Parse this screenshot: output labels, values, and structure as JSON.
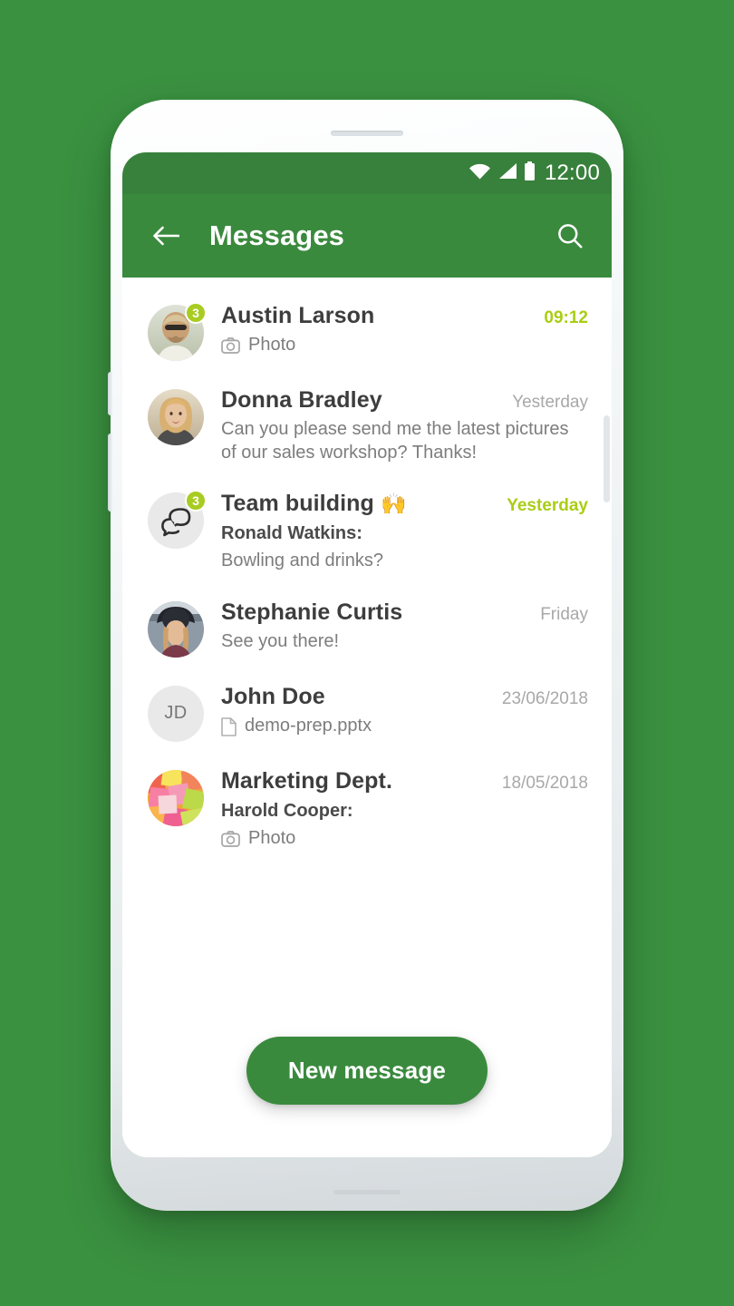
{
  "theme": {
    "backdrop_green": "#3a9140",
    "appbar_green": "#3a8a3e",
    "statusbar_green": "#38813c",
    "accent_lime": "#aacd16",
    "badge_lime": "#a8cc22",
    "name_color": "#3d3d3d",
    "preview_color": "#7d7d7d",
    "muted_time_color": "#a8a8a8"
  },
  "statusbar": {
    "time": "12:00",
    "icons": [
      "wifi-icon",
      "cellular-signal-icon",
      "battery-icon"
    ]
  },
  "appbar": {
    "back_icon": "back-arrow-icon",
    "title": "Messages",
    "search_icon": "search-icon"
  },
  "conversations": [
    {
      "name": "Austin Larson",
      "emoji": "",
      "time": "09:12",
      "time_accent": true,
      "sender": "",
      "preview": "Photo",
      "preview_icon": "camera-icon",
      "badge": "3",
      "avatar_type": "photo-man-sunglasses"
    },
    {
      "name": "Donna Bradley",
      "emoji": "",
      "time": "Yesterday",
      "time_accent": false,
      "sender": "",
      "preview": "Can you please send me the latest pictures of our sales workshop? Thanks!",
      "preview_icon": "",
      "badge": "",
      "avatar_type": "photo-woman-blonde"
    },
    {
      "name": "Team building",
      "emoji": "🙌",
      "time": "Yesterday",
      "time_accent": true,
      "sender": "Ronald Watkins:",
      "preview": "Bowling and drinks?",
      "preview_icon": "",
      "badge": "3",
      "avatar_type": "group-chat-bubbles"
    },
    {
      "name": "Stephanie Curtis",
      "emoji": "",
      "time": "Friday",
      "time_accent": false,
      "sender": "",
      "preview": "See you there!",
      "preview_icon": "",
      "badge": "",
      "avatar_type": "photo-woman-hat"
    },
    {
      "name": "John Doe",
      "emoji": "",
      "time": "23/06/2018",
      "time_accent": false,
      "sender": "",
      "preview": "demo-prep.pptx",
      "preview_icon": "document-icon",
      "badge": "",
      "avatar_type": "initials",
      "initials": "JD"
    },
    {
      "name": "Marketing Dept.",
      "emoji": "",
      "time": "18/05/2018",
      "time_accent": false,
      "sender": "Harold Cooper:",
      "preview": "Photo",
      "preview_icon": "camera-icon",
      "badge": "",
      "avatar_type": "photo-sticky-notes"
    }
  ],
  "fab": {
    "label": "New message"
  }
}
